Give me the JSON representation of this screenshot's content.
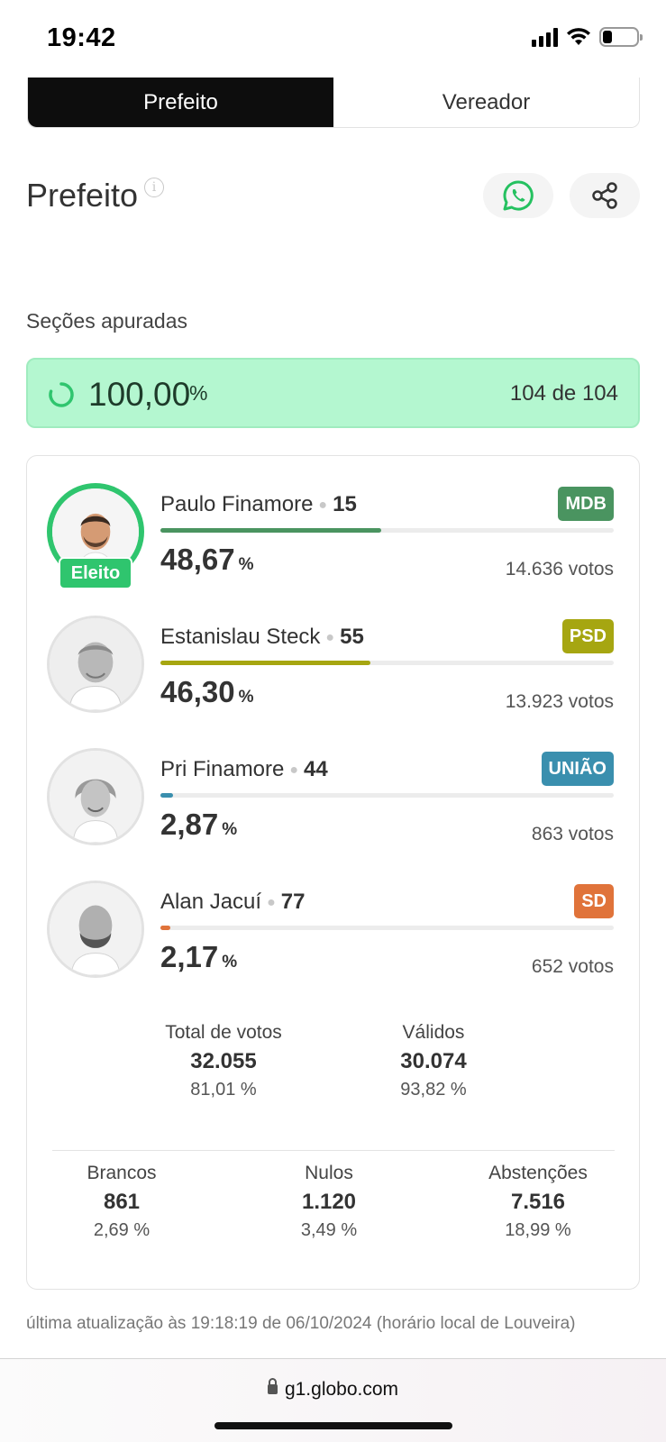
{
  "status_bar": {
    "time": "19:42"
  },
  "tabs": [
    {
      "label": "Prefeito",
      "active": true
    },
    {
      "label": "Vereador",
      "active": false
    }
  ],
  "section": {
    "title": "Prefeito",
    "info_icon": "info-icon",
    "whatsapp_icon": "whatsapp-icon",
    "share_icon": "share-icon"
  },
  "secoes": {
    "label": "Seções apuradas",
    "percent": "100,00",
    "percent_sign": "%",
    "count": "104 de 104"
  },
  "candidates": [
    {
      "name": "Paulo Finamore",
      "number": "15",
      "party": "MDB",
      "party_color": "#4a9460",
      "percent": "48,67",
      "percent_value": 48.67,
      "votes": "14.636 votos",
      "elected": true,
      "elected_label": "Eleito",
      "bar_color": "#4a9460"
    },
    {
      "name": "Estanislau Steck",
      "number": "55",
      "party": "PSD",
      "party_color": "#a6a611",
      "percent": "46,30",
      "percent_value": 46.3,
      "votes": "13.923 votos",
      "elected": false,
      "bar_color": "#a6a611"
    },
    {
      "name": "Pri Finamore",
      "number": "44",
      "party": "UNIÃO",
      "party_color": "#3a8fae",
      "percent": "2,87",
      "percent_value": 2.87,
      "votes": "863 votos",
      "elected": false,
      "bar_color": "#3a8fae"
    },
    {
      "name": "Alan Jacuí",
      "number": "77",
      "party": "SD",
      "party_color": "#e0733a",
      "percent": "2,17",
      "percent_value": 2.17,
      "votes": "652 votos",
      "elected": false,
      "bar_color": "#e0733a"
    }
  ],
  "percent_unit": "%",
  "summary": {
    "total": {
      "label": "Total de votos",
      "value": "32.055",
      "percent": "81,01 %"
    },
    "validos": {
      "label": "Válidos",
      "value": "30.074",
      "percent": "93,82 %"
    },
    "brancos": {
      "label": "Brancos",
      "value": "861",
      "percent": "2,69 %"
    },
    "nulos": {
      "label": "Nulos",
      "value": "1.120",
      "percent": "3,49 %"
    },
    "abstencoes": {
      "label": "Abstenções",
      "value": "7.516",
      "percent": "18,99 %"
    }
  },
  "last_update": "última atualização às 19:18:19 de 06/10/2024 (horário local de Louveira)",
  "browser": {
    "url": "g1.globo.com"
  },
  "colors": {
    "accent_green": "#2fc56e",
    "progress_bg": "#b4f7d0"
  }
}
